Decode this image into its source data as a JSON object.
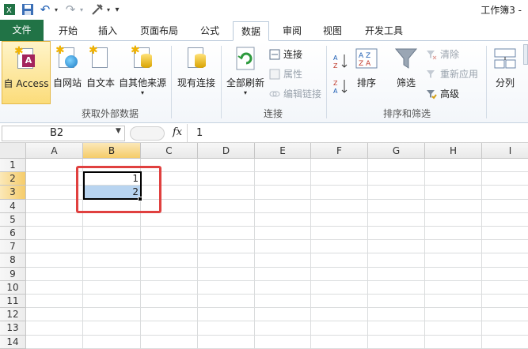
{
  "title": "工作簿3 -",
  "qat": {
    "undo_symbol": "↶",
    "redo_symbol": "↷",
    "customize_symbol": "▾"
  },
  "tabs": [
    {
      "label": "文件"
    },
    {
      "label": "开始"
    },
    {
      "label": "插入"
    },
    {
      "label": "页面布局"
    },
    {
      "label": "公式"
    },
    {
      "label": "数据"
    },
    {
      "label": "审阅"
    },
    {
      "label": "视图"
    },
    {
      "label": "开发工具"
    }
  ],
  "active_tab": "数据",
  "ribbon": {
    "external": {
      "group_label": "获取外部数据",
      "access": "自 Access",
      "web": "自网站",
      "text": "自文本",
      "other": "自其他来源",
      "existing": "现有连接"
    },
    "connections": {
      "group_label": "连接",
      "refresh_all": "全部刷新",
      "connections": "连接",
      "properties": "属性",
      "edit_links": "编辑链接"
    },
    "sort_filter": {
      "group_label": "排序和筛选",
      "sort_az": "A Z",
      "sort_za": "Z A",
      "sort": "排序",
      "filter": "筛选",
      "clear": "清除",
      "reapply": "重新应用",
      "advanced": "高级"
    },
    "tools": {
      "split": "分列"
    }
  },
  "formula_bar": {
    "name_box": "B2",
    "fx": "fx",
    "value": "1"
  },
  "columns": [
    "A",
    "B",
    "C",
    "D",
    "E",
    "F",
    "G",
    "H",
    "I"
  ],
  "rows": [
    "1",
    "2",
    "3",
    "4",
    "5",
    "6",
    "7",
    "8",
    "9",
    "10",
    "11",
    "12",
    "13",
    "14"
  ],
  "cells": {
    "B2": "1",
    "B3": "2"
  },
  "colors": {
    "file_tab": "#217346",
    "selection": "#b8d4f0",
    "annotation": "#e0403f",
    "header_selected": "#f5cc6a"
  }
}
